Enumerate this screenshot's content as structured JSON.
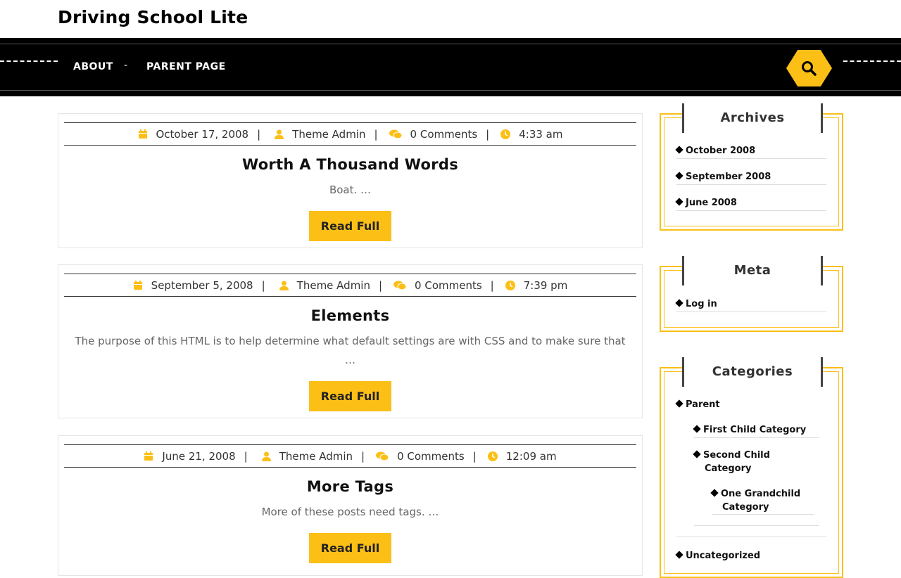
{
  "site": {
    "title": "Driving School Lite"
  },
  "nav": {
    "items": [
      {
        "label": "ABOUT"
      },
      {
        "label": "PARENT PAGE"
      }
    ],
    "separator": "-"
  },
  "colors": {
    "accent": "#fbbf16",
    "navbar": "#000000"
  },
  "posts": [
    {
      "date": "October 17, 2008",
      "author": "Theme Admin",
      "comments": "0 Comments",
      "time": "4:33 am",
      "title": "Worth A Thousand Words",
      "excerpt": "Boat. …",
      "button": "Read Full"
    },
    {
      "date": "September 5, 2008",
      "author": "Theme Admin",
      "comments": "0 Comments",
      "time": "7:39 pm",
      "title": "Elements",
      "excerpt": "The purpose of this HTML is to help determine what default settings are with CSS and to make sure that …",
      "button": "Read Full"
    },
    {
      "date": "June 21, 2008",
      "author": "Theme Admin",
      "comments": "0 Comments",
      "time": "12:09 am",
      "title": "More Tags",
      "excerpt": "More of these posts need tags. …",
      "button": "Read Full"
    }
  ],
  "sidebar": {
    "archives": {
      "title": "Archives",
      "items": [
        "October 2008",
        "September 2008",
        "June 2008"
      ]
    },
    "meta": {
      "title": "Meta",
      "items": [
        "Log in"
      ]
    },
    "categories": {
      "title": "Categories",
      "items": [
        "Parent",
        "First Child Category",
        "Second Child Category",
        "One Grandchild Category",
        "Uncategorized"
      ]
    }
  },
  "separators": {
    "meta": "|"
  }
}
